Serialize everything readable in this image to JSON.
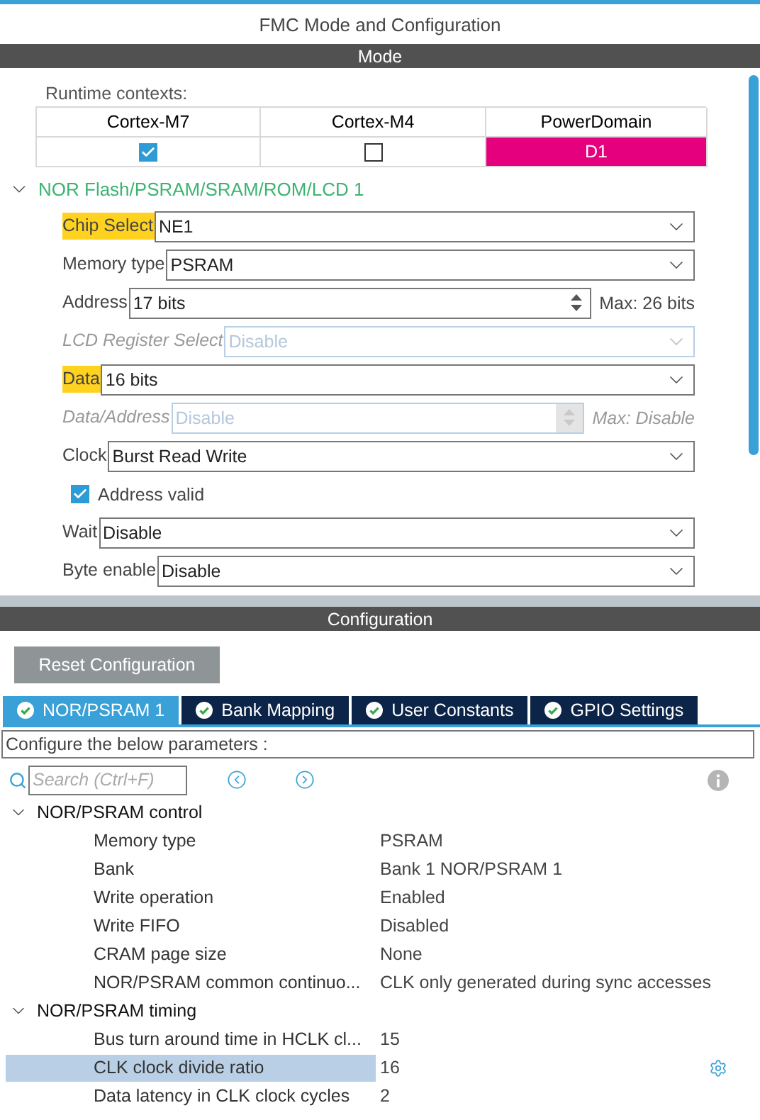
{
  "title": "FMC Mode and Configuration",
  "mode": {
    "header": "Mode",
    "runtime_label": "Runtime contexts:",
    "contexts": [
      {
        "name": "Cortex-M7",
        "kind": "checkbox",
        "checked": true
      },
      {
        "name": "Cortex-M4",
        "kind": "checkbox",
        "checked": false
      },
      {
        "name": "PowerDomain",
        "kind": "domain",
        "value": "D1",
        "color": "#e5007e"
      }
    ],
    "section": {
      "title": "NOR Flash/PSRAM/SRAM/ROM/LCD 1",
      "expanded": true,
      "fields": [
        {
          "kind": "select",
          "label": "Chip Select",
          "value": "NE1",
          "highlighted": true,
          "disabled": false
        },
        {
          "kind": "select",
          "label": "Memory type",
          "value": "PSRAM",
          "highlighted": false,
          "disabled": false
        },
        {
          "kind": "spin",
          "label": "Address",
          "value": "17 bits",
          "suffix": "Max: 26 bits",
          "highlighted": false,
          "disabled": false
        },
        {
          "kind": "select",
          "label": "LCD Register Select",
          "value": "Disable",
          "highlighted": false,
          "disabled": true
        },
        {
          "kind": "select",
          "label": "Data",
          "value": "16 bits",
          "highlighted": true,
          "disabled": false
        },
        {
          "kind": "spin",
          "label": "Data/Address",
          "value": "Disable",
          "suffix": "Max: Disable",
          "highlighted": false,
          "disabled": true
        },
        {
          "kind": "select",
          "label": "Clock",
          "value": "Burst Read Write",
          "highlighted": false,
          "disabled": false
        },
        {
          "kind": "checkbox",
          "label": "Address valid",
          "checked": true
        },
        {
          "kind": "select",
          "label": "Wait",
          "value": "Disable",
          "highlighted": false,
          "disabled": false
        },
        {
          "kind": "select",
          "label": "Byte enable",
          "value": "Disable",
          "highlighted": false,
          "disabled": false
        }
      ]
    }
  },
  "configuration": {
    "header": "Configuration",
    "reset_button": "Reset Configuration",
    "tabs": [
      {
        "label": "NOR/PSRAM 1",
        "selected": true
      },
      {
        "label": "Bank Mapping",
        "selected": false
      },
      {
        "label": "User Constants",
        "selected": false
      },
      {
        "label": "GPIO Settings",
        "selected": false
      }
    ],
    "description": "Configure the below parameters :",
    "search": {
      "placeholder": "Search (Ctrl+F)"
    },
    "groups": [
      {
        "title": "NOR/PSRAM control",
        "expanded": true,
        "params": [
          {
            "name": "Memory type",
            "value": "PSRAM",
            "selected": false
          },
          {
            "name": "Bank",
            "value": "Bank 1 NOR/PSRAM 1",
            "selected": false
          },
          {
            "name": "Write operation",
            "value": "Enabled",
            "selected": false
          },
          {
            "name": "Write FIFO",
            "value": "Disabled",
            "selected": false
          },
          {
            "name": "CRAM page size",
            "value": "None",
            "selected": false
          },
          {
            "name": "NOR/PSRAM common continuo...",
            "value": "CLK only generated during sync accesses",
            "selected": false
          }
        ]
      },
      {
        "title": "NOR/PSRAM timing",
        "expanded": true,
        "params": [
          {
            "name": "Bus turn around time in HCLK cl...",
            "value": "15",
            "selected": false
          },
          {
            "name": "CLK clock divide ratio",
            "value": "16",
            "selected": true
          },
          {
            "name": "Data latency in CLK clock cycles",
            "value": "2",
            "selected": false
          }
        ]
      }
    ]
  }
}
